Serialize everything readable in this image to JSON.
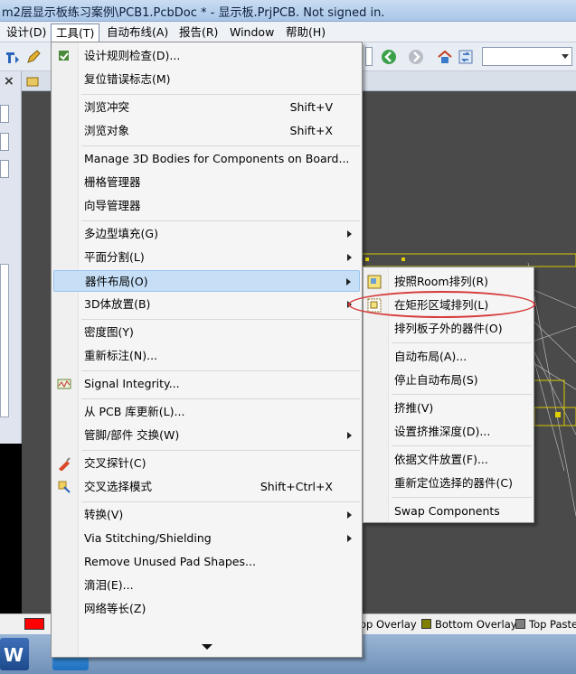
{
  "window": {
    "title": "m2层显示板练习案例\\PCB1.PcbDoc * - 显示板.PrjPCB. Not signed in."
  },
  "menubar": [
    {
      "label": "设计(D)"
    },
    {
      "label": "工具(T)"
    },
    {
      "label": "自动布线(A)"
    },
    {
      "label": "报告(R)"
    },
    {
      "label": "Window"
    },
    {
      "label": "帮助(H)"
    }
  ],
  "tools_menu": {
    "items": [
      {
        "label": "设计规则检查(D)...",
        "shortcut": "",
        "icon": "drc-check-icon"
      },
      {
        "label": "复位错误标志(M)",
        "shortcut": ""
      },
      {
        "label": "浏览冲突",
        "shortcut": "Shift+V"
      },
      {
        "label": "浏览对象",
        "shortcut": "Shift+X"
      },
      {
        "label": "Manage 3D Bodies for Components on Board...",
        "shortcut": ""
      },
      {
        "label": "栅格管理器",
        "shortcut": ""
      },
      {
        "label": "向导管理器",
        "shortcut": ""
      },
      {
        "label": "多边型填充(G)",
        "shortcut": ""
      },
      {
        "label": "平面分割(L)",
        "shortcut": ""
      },
      {
        "label": "器件布局(O)",
        "shortcut": ""
      },
      {
        "label": "3D体放置(B)",
        "shortcut": ""
      },
      {
        "label": "密度图(Y)",
        "shortcut": ""
      },
      {
        "label": "重新标注(N)...",
        "shortcut": ""
      },
      {
        "label": "Signal Integrity...",
        "shortcut": "",
        "icon": "signal-integrity-icon"
      },
      {
        "label": "从 PCB 库更新(L)...",
        "shortcut": ""
      },
      {
        "label": "管脚/部件 交换(W)",
        "shortcut": ""
      },
      {
        "label": "交叉探针(C)",
        "shortcut": "",
        "icon": "cross-probe-icon"
      },
      {
        "label": "交叉选择模式",
        "shortcut": "Shift+Ctrl+X",
        "icon": "cross-select-icon"
      },
      {
        "label": "转换(V)",
        "shortcut": ""
      },
      {
        "label": "Via Stitching/Shielding",
        "shortcut": ""
      },
      {
        "label": "Remove Unused Pad Shapes...",
        "shortcut": ""
      },
      {
        "label": "滴泪(E)...",
        "shortcut": ""
      },
      {
        "label": "网络等长(Z)",
        "shortcut": ""
      }
    ]
  },
  "component_placement_submenu": {
    "items": [
      {
        "label": "按照Room排列(R)"
      },
      {
        "label": "在矩形区域排列(L)"
      },
      {
        "label": "排列板子外的器件(O)"
      },
      {
        "label": "自动布局(A)..."
      },
      {
        "label": "停止自动布局(S)"
      },
      {
        "label": "挤推(V)"
      },
      {
        "label": "设置挤推深度(D)..."
      },
      {
        "label": "依据文件放置(F)..."
      },
      {
        "label": "重新定位选择的器件(C)"
      },
      {
        "label": "Swap Components"
      }
    ]
  },
  "layer_tabs": [
    {
      "label": "op Overlay",
      "color": "#ffff00"
    },
    {
      "label": "Bottom Overlay",
      "color": "#808000"
    },
    {
      "label": "Top Paste",
      "color": "#808080"
    }
  ],
  "colors": {
    "highlight": "#c6dff7",
    "annotation_red": "#d63a3a",
    "pcb_background": "#4a4a4a",
    "current_layer": "#ff0000"
  }
}
